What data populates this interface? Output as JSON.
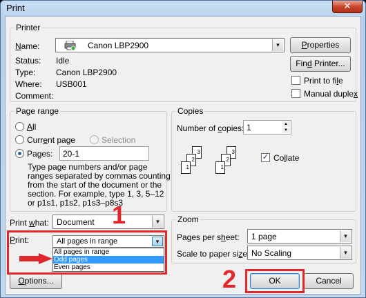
{
  "window": {
    "title": "Print",
    "close_glyph": "✕"
  },
  "printer": {
    "group_title": "Printer",
    "name_label": "Name:",
    "name_value": "Canon LBP2900",
    "properties_button": "Properties",
    "status_label": "Status:",
    "status_value": "Idle",
    "type_label": "Type:",
    "type_value": "Canon LBP2900",
    "where_label": "Where:",
    "where_value": "USB001",
    "comment_label": "Comment:",
    "find_printer_button": "Find Printer...",
    "print_to_file_label": "Print to file",
    "manual_duplex_label": "Manual duplex"
  },
  "page_range": {
    "group_title": "Page range",
    "all_label": "All",
    "current_page_label": "Current page",
    "selection_label": "Selection",
    "pages_label": "Pages:",
    "pages_value": "20-1",
    "desc": [
      "Type page numbers and/or page",
      "ranges separated by commas counting",
      "from the start of the document or the",
      "section. For example, type 1, 3, 5–12",
      "or p1s1, p1s2, p1s3–p8s3"
    ]
  },
  "copies": {
    "group_title": "Copies",
    "number_label": "Number of copies:",
    "number_value": "1",
    "collate_label": "Collate",
    "page_numbers": [
      "3",
      "2",
      "1",
      "3",
      "2",
      "1"
    ]
  },
  "print_what": {
    "label": "Print what:",
    "value": "Document"
  },
  "print": {
    "label": "Print:",
    "value": "All pages in range",
    "options": [
      "All pages in range",
      "Odd pages",
      "Even pages"
    ],
    "selected_index": 1
  },
  "zoom": {
    "group_title": "Zoom",
    "pages_per_sheet_label": "Pages per sheet:",
    "pages_per_sheet_value": "1 page",
    "scale_label": "Scale to paper size:",
    "scale_value": "No Scaling"
  },
  "buttons": {
    "options": "Options...",
    "ok": "OK",
    "cancel": "Cancel"
  },
  "annotations": {
    "step1": "1",
    "step2": "2",
    "color": "#e0282c"
  }
}
